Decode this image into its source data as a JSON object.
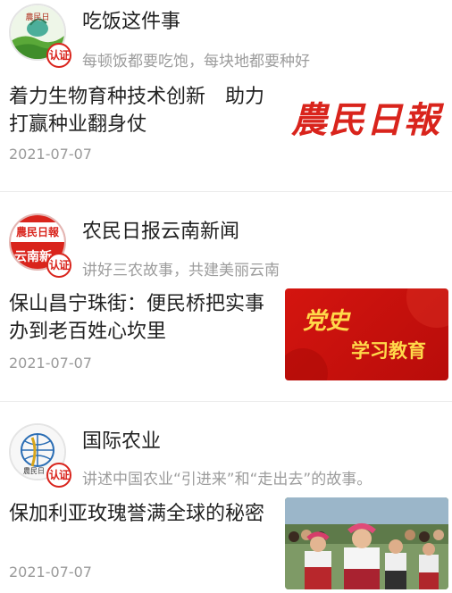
{
  "feed": [
    {
      "source_name": "吃饭这件事",
      "source_desc": "每顿饭都要吃饱，每块地都要种好",
      "badge": "认证",
      "title": "着力生物育种技术创新　助力打赢种业翻身仗",
      "date": "2021-07-07",
      "thumb_text": "農民日報"
    },
    {
      "source_name": "农民日报云南新闻",
      "source_desc": "讲好三农故事，共建美丽云南",
      "badge": "认证",
      "avatar_text_top": "農民日報",
      "avatar_text_bottom": "云南新",
      "title": "保山昌宁珠街：便民桥把实事办到老百姓心坎里",
      "date": "2021-07-07",
      "thumb_text_top": "党史",
      "thumb_text_bottom": "学习教育"
    },
    {
      "source_name": "国际农业",
      "source_desc": "讲述中国农业“引进来”和“走出去”的故事。",
      "badge": "认证",
      "title": "保加利亚玫瑰誉满全球的秘密",
      "date": "2021-07-07"
    }
  ],
  "colors": {
    "brand_red": "#d9241c",
    "party_red": "#c8120f",
    "party_gold": "#ffd94a"
  }
}
